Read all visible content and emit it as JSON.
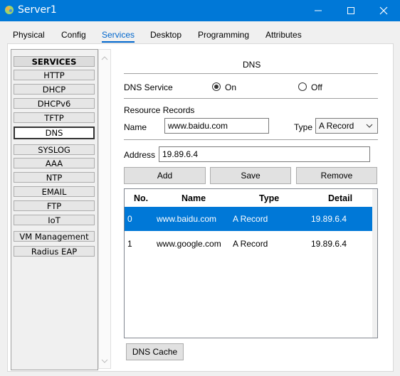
{
  "window": {
    "title": "Server1"
  },
  "tabs": [
    "Physical",
    "Config",
    "Services",
    "Desktop",
    "Programming",
    "Attributes"
  ],
  "services": {
    "header": "SERVICES",
    "items": [
      "HTTP",
      "DHCP",
      "DHCPv6",
      "TFTP",
      "DNS",
      "SYSLOG",
      "AAA",
      "NTP",
      "EMAIL",
      "FTP",
      "IoT",
      "VM Management",
      "Radius EAP"
    ],
    "selected": "DNS"
  },
  "dns": {
    "section_title": "DNS",
    "service_label": "DNS Service",
    "on_label": "On",
    "off_label": "Off",
    "service_state": "On",
    "resource_records_label": "Resource Records",
    "name_label": "Name",
    "name_value": "www.baidu.com",
    "type_label": "Type",
    "type_value": "A Record",
    "address_label": "Address",
    "address_value": "19.89.6.4",
    "buttons": {
      "add": "Add",
      "save": "Save",
      "remove": "Remove"
    },
    "table": {
      "headers": [
        "No.",
        "Name",
        "Type",
        "Detail"
      ],
      "rows": [
        {
          "no": "0",
          "name": "www.baidu.com",
          "type": "A Record",
          "detail": "19.89.6.4",
          "selected": true
        },
        {
          "no": "1",
          "name": "www.google.com",
          "type": "A Record",
          "detail": "19.89.6.4",
          "selected": false
        }
      ]
    },
    "cache_button": "DNS Cache"
  },
  "colors": {
    "titlebar": "#0078d7",
    "selection": "#0078d7",
    "active_tab": "#0066cc"
  },
  "icons": [
    "server-app-icon",
    "minimize-icon",
    "maximize-icon",
    "close-icon",
    "scroll-up-icon",
    "scroll-down-icon",
    "dropdown-chevron-icon"
  ]
}
